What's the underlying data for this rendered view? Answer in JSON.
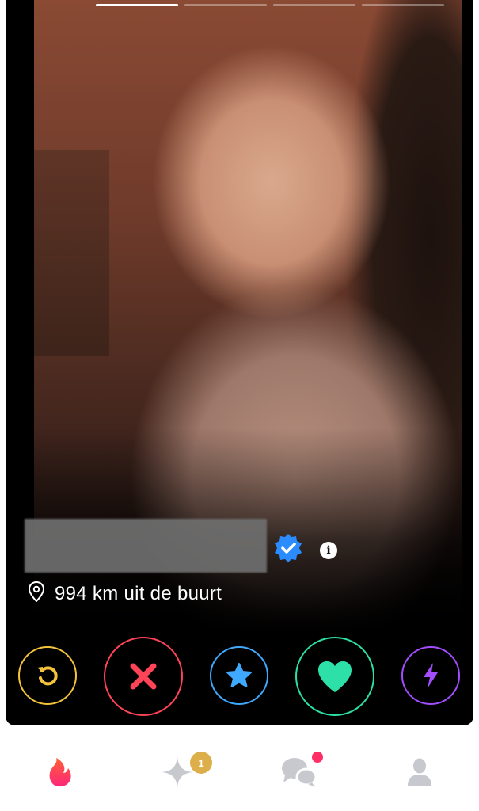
{
  "profile": {
    "distance": "994 km uit de buurt",
    "info_glyph": "i",
    "verified_icon": "verified-badge-icon",
    "photo_count": 4,
    "active_photo": 1
  },
  "actions": [
    {
      "name": "rewind",
      "icon": "rewind-icon",
      "color": "#f3c33b"
    },
    {
      "name": "nope",
      "icon": "close-icon",
      "color": "#ff4458"
    },
    {
      "name": "super-like",
      "icon": "star-icon",
      "color": "#3fa9ff"
    },
    {
      "name": "like",
      "icon": "heart-icon",
      "color": "#2de0a7"
    },
    {
      "name": "boost",
      "icon": "bolt-icon",
      "color": "#a34dff"
    }
  ],
  "tabs": {
    "home": {
      "icon": "flame-icon",
      "active": true
    },
    "top_picks": {
      "icon": "sparkle-icon",
      "badge": "1"
    },
    "messages": {
      "icon": "chat-bubbles-icon",
      "has_notification": true
    },
    "profile": {
      "icon": "person-icon"
    }
  },
  "colors": {
    "brand_gradient_start": "#fd267a",
    "brand_gradient_end": "#ff6036",
    "badge": "#dcaf4a",
    "notification": "#ff2f66"
  }
}
